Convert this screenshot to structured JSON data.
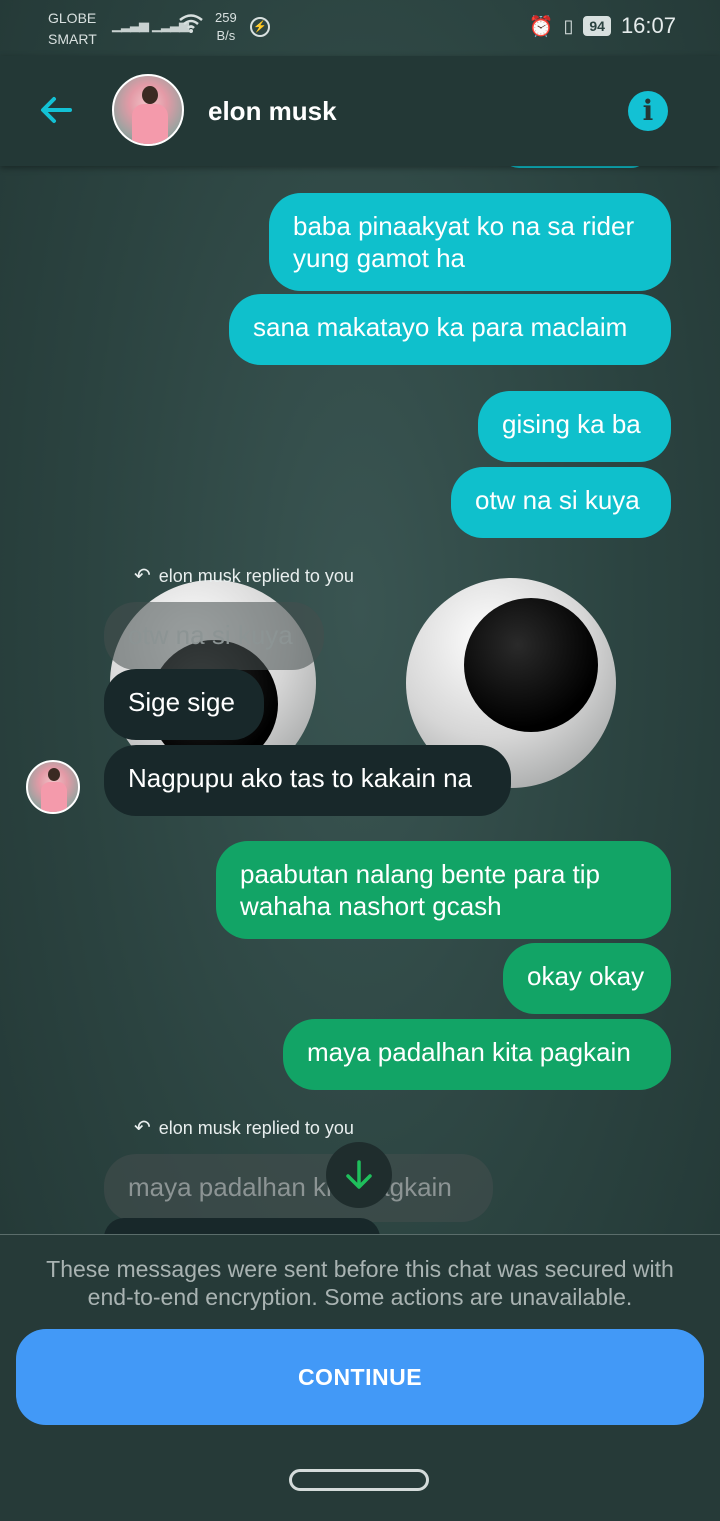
{
  "status_bar": {
    "carrier_line1": "GLOBE",
    "carrier_line2": "SMART",
    "speed_value": "259",
    "speed_unit": "B/s",
    "battery": "94",
    "time": "16:07"
  },
  "header": {
    "contact_name": "elon musk",
    "back_icon": "arrow-left-icon",
    "info_icon": "info-icon",
    "accent_color": "#13c1d4"
  },
  "messages": {
    "outgoing_1": "baba pinaakyat ko na sa rider yung gamot ha",
    "outgoing_2": "sana makatayo ka para maclaim",
    "outgoing_3": "gising ka ba",
    "outgoing_4": "otw na si kuya",
    "reply_label_1": "elon musk replied to you",
    "quoted_1": "otw na si kuya",
    "incoming_1": "Sige sige",
    "incoming_2": "Nagpupu ako tas to kakain na",
    "outgoing_5": "paabutan nalang bente para tip wahaha nashort gcash",
    "outgoing_6": "okay okay",
    "outgoing_7": "maya padalhan kita pagkain",
    "reply_label_2": "elon musk replied to you",
    "quoted_2": "maya padalhan kita pagkain"
  },
  "bottom": {
    "notice": "These messages were sent before this chat was secured with end-to-end encryption. Some actions are unavailable.",
    "continue_label": "CONTINUE",
    "button_color": "#4299f7"
  }
}
